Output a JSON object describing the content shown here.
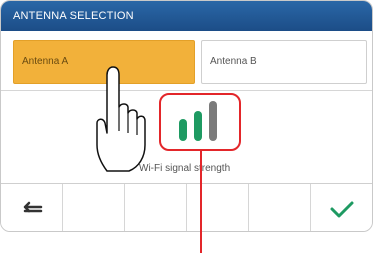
{
  "window": {
    "title": "ANTENNA SELECTION"
  },
  "antennas": [
    {
      "label": "Antenna A",
      "selected": true
    },
    {
      "label": "Antenna B",
      "selected": false
    }
  ],
  "signal": {
    "label": "Wi-Fi signal strength",
    "level": 2,
    "max": 3
  },
  "bottom_bar": [
    {
      "icon": "back-icon"
    },
    {
      "icon": ""
    },
    {
      "icon": ""
    },
    {
      "icon": ""
    },
    {
      "icon": ""
    },
    {
      "icon": "check-icon"
    }
  ],
  "colors": {
    "title_bar": "#1c4d87",
    "selected": "#f2b13a",
    "signal": "#1e9a62",
    "annotation": "#e3262a"
  }
}
